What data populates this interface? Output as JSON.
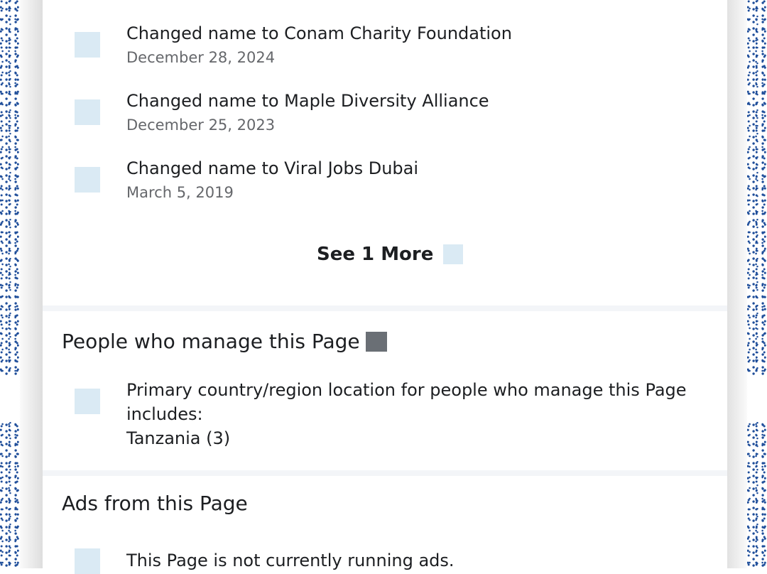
{
  "name_history": {
    "items": [
      {
        "title": "Changed name to Conam Charity Foundation",
        "date": "December 28, 2024"
      },
      {
        "title": "Changed name to Maple Diversity Alliance",
        "date": "December 25, 2023"
      },
      {
        "title": "Changed name to Viral Jobs Dubai",
        "date": "March 5, 2019"
      }
    ],
    "see_more_label": "See 1 More"
  },
  "managers": {
    "heading": "People who manage this Page",
    "description_line1": "Primary country/region location for people who manage this Page",
    "description_line2": "includes:",
    "location": "Tanzania (3)"
  },
  "ads": {
    "heading": "Ads from this Page",
    "status": "This Page is not currently running ads."
  },
  "colors": {
    "icon_placeholder": "#daeaf4",
    "border_speckle": "#1f4e9a",
    "text_primary": "#1c1e21",
    "text_secondary": "#65676b",
    "info_icon": "#6a6f75"
  },
  "icons": {
    "history_item": "history-icon",
    "see_more": "chevron-down-icon",
    "info": "info-icon",
    "location": "location-icon",
    "ads": "ads-icon"
  }
}
